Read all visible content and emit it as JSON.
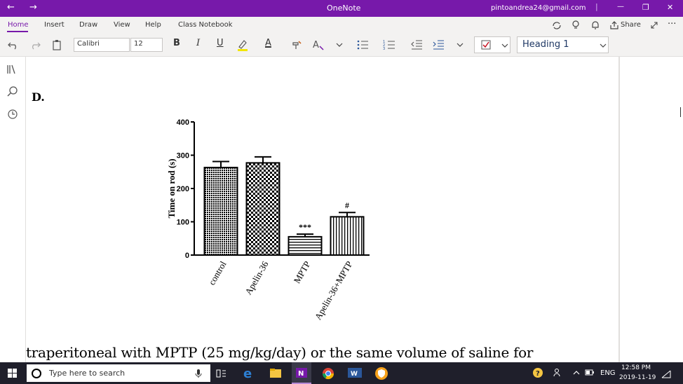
{
  "titlebar": {
    "app_title": "OneNote",
    "account": "pintoandrea24@gmail.com",
    "back_glyph": "←",
    "forward_glyph": "→",
    "minimize_glyph": "—",
    "restore_glyph": "❐",
    "close_glyph": "✕"
  },
  "menu": {
    "tabs": [
      "Home",
      "Insert",
      "Draw",
      "View",
      "Help",
      "Class Notebook"
    ],
    "share_label": "Share",
    "more_glyph": "···"
  },
  "toolbar": {
    "font_name": "Calibri",
    "font_size": "12",
    "bold": "B",
    "italic": "I",
    "underline": "U",
    "font_color": "A",
    "style_value": "Heading 1"
  },
  "document": {
    "section_label": "D.",
    "body_text": "traperitoneal with MPTP (25 mg/kg/day) or the same volume of saline for"
  },
  "chart_data": {
    "type": "bar",
    "ylabel": "Time on rod (s)",
    "ylim": [
      0,
      400
    ],
    "yticks": [
      0,
      100,
      200,
      300,
      400
    ],
    "categories": [
      "control",
      "Apelin-36",
      "MPTP",
      "Apelin-36+MPTP"
    ],
    "values": [
      263,
      277,
      55,
      115
    ],
    "errors": [
      18,
      18,
      8,
      13
    ],
    "annotations": [
      "",
      "",
      "***",
      "#"
    ],
    "patterns": [
      "dense-dots",
      "checker",
      "horizontal-lines",
      "vertical-lines"
    ],
    "grid": false,
    "legend": "none"
  },
  "taskbar": {
    "search_placeholder": "Type here to search",
    "language": "ENG",
    "time": "12:58 PM",
    "date": "2019-11-19"
  }
}
